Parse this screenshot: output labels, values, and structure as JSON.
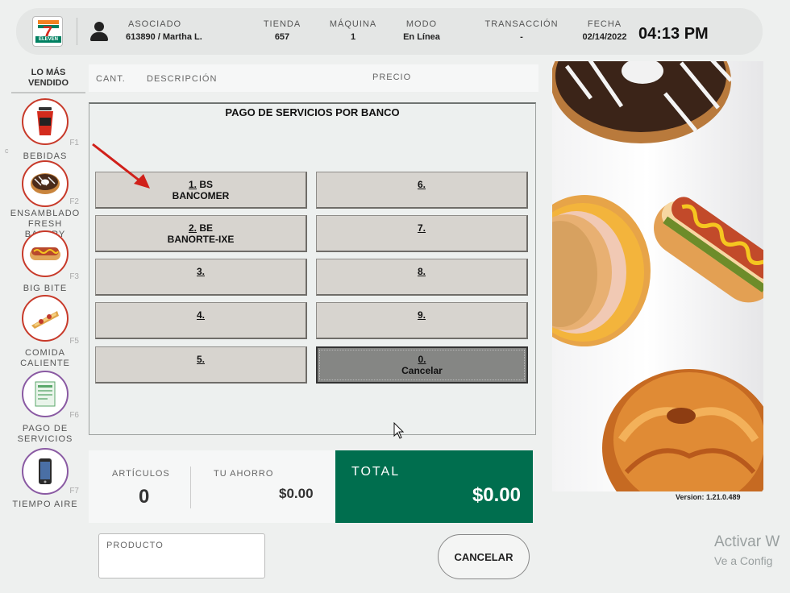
{
  "header": {
    "associate_label": "ASOCIADO",
    "associate_value": "613890 / Martha L.",
    "store_label": "TIENDA",
    "store_value": "657",
    "machine_label": "MÁQUINA",
    "machine_value": "1",
    "mode_label": "MODO",
    "mode_value": "En Línea",
    "transaction_label": "TRANSACCIÓN",
    "transaction_value": "-",
    "date_label": "FECHA",
    "date_value": "02/14/2022",
    "time": "04:13 PM",
    "logo_text": "ELEVEN",
    "logo_number": "7"
  },
  "rail": {
    "title": "LO MÁS VENDIDO",
    "items": [
      {
        "label": "BEBIDAS",
        "fkey": "F1",
        "icon": "cup-icon"
      },
      {
        "label": "ENSAMBLADO FRESH BAKERY",
        "fkey": "F2",
        "icon": "donut-icon"
      },
      {
        "label": "BIG BITE",
        "fkey": "F3",
        "icon": "hotdog-icon"
      },
      {
        "label": "COMIDA CALIENTE",
        "fkey": "F5",
        "icon": "pizza-icon"
      },
      {
        "label": "PAGO DE SERVICIOS",
        "fkey": "F6",
        "icon": "receipt-icon"
      },
      {
        "label": "TIEMPO AIRE",
        "fkey": "F7",
        "icon": "phone-icon"
      }
    ]
  },
  "columns": {
    "qty": "CANT.",
    "description": "DESCRIPCIÓN",
    "price": "PRECIO"
  },
  "panel": {
    "title": "PAGO DE SERVICIOS POR BANCO",
    "buttons": [
      {
        "num": "1.",
        "code": "BS",
        "name": "BANCOMER"
      },
      {
        "num": "2.",
        "code": "BE",
        "name": "BANORTE-IXE"
      },
      {
        "num": "3.",
        "code": "",
        "name": ""
      },
      {
        "num": "4.",
        "code": "",
        "name": ""
      },
      {
        "num": "5.",
        "code": "",
        "name": ""
      },
      {
        "num": "6.",
        "code": "",
        "name": ""
      },
      {
        "num": "7.",
        "code": "",
        "name": ""
      },
      {
        "num": "8.",
        "code": "",
        "name": ""
      },
      {
        "num": "9.",
        "code": "",
        "name": ""
      },
      {
        "num": "0.",
        "code": "",
        "name": "Cancelar"
      }
    ]
  },
  "totals": {
    "items_label": "ARTÍCULOS",
    "items_value": "0",
    "savings_label": "TU AHORRO",
    "savings_value": "$0.00",
    "total_label": "TOTAL",
    "total_value": "$0.00"
  },
  "product_label": "PRODUCTO",
  "cancel_label": "CANCELAR",
  "version": "Version: 1.21.0.489",
  "activation": {
    "line1": "Activar W",
    "line2": "Ve a Config"
  },
  "colors": {
    "accent_green": "#006e4e",
    "cat_red": "#c83a2a",
    "cat_purple": "#8a5aa3",
    "arrow_red": "#d0201a"
  }
}
